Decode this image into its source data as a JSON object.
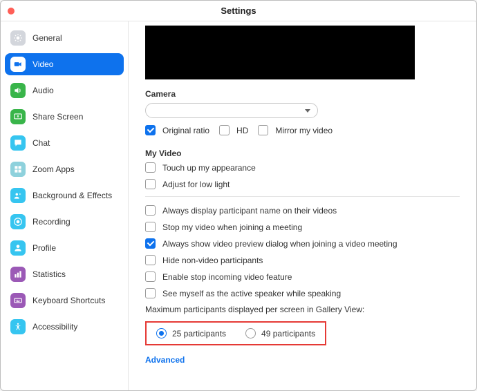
{
  "window": {
    "title": "Settings"
  },
  "sidebar": {
    "items": [
      {
        "id": "general",
        "label": "General",
        "bg": "#d3d6dc",
        "fg": "#fff",
        "active": false
      },
      {
        "id": "video",
        "label": "Video",
        "bg": "#fff",
        "fg": "#0e72ed",
        "active": true
      },
      {
        "id": "audio",
        "label": "Audio",
        "bg": "#39b54a",
        "fg": "#fff",
        "active": false
      },
      {
        "id": "share-screen",
        "label": "Share Screen",
        "bg": "#39b54a",
        "fg": "#fff",
        "active": false
      },
      {
        "id": "chat",
        "label": "Chat",
        "bg": "#36c5f0",
        "fg": "#fff",
        "active": false
      },
      {
        "id": "zoom-apps",
        "label": "Zoom Apps",
        "bg": "#8ed1dc",
        "fg": "#fff",
        "active": false
      },
      {
        "id": "background-effects",
        "label": "Background & Effects",
        "bg": "#36c5f0",
        "fg": "#fff",
        "active": false
      },
      {
        "id": "recording",
        "label": "Recording",
        "bg": "#36c5f0",
        "fg": "#fff",
        "active": false
      },
      {
        "id": "profile",
        "label": "Profile",
        "bg": "#36c5f0",
        "fg": "#fff",
        "active": false
      },
      {
        "id": "statistics",
        "label": "Statistics",
        "bg": "#9b59b6",
        "fg": "#fff",
        "active": false
      },
      {
        "id": "keyboard-shortcuts",
        "label": "Keyboard Shortcuts",
        "bg": "#9b59b6",
        "fg": "#fff",
        "active": false
      },
      {
        "id": "accessibility",
        "label": "Accessibility",
        "bg": "#36c5f0",
        "fg": "#fff",
        "active": false
      }
    ]
  },
  "camera": {
    "heading": "Camera",
    "selected": "",
    "options_row": {
      "original_ratio": {
        "label": "Original ratio",
        "checked": true
      },
      "hd": {
        "label": "HD",
        "checked": false
      },
      "mirror": {
        "label": "Mirror my video",
        "checked": false
      }
    }
  },
  "my_video": {
    "heading": "My Video",
    "touch_up": {
      "label": "Touch up my appearance",
      "checked": false
    },
    "low_light": {
      "label": "Adjust for low light",
      "checked": false
    }
  },
  "meeting_opts": {
    "display_name": {
      "label": "Always display participant name on their videos",
      "checked": false
    },
    "stop_on_join": {
      "label": "Stop my video when joining a meeting",
      "checked": false
    },
    "preview_dialog": {
      "label": "Always show video preview dialog when joining a video meeting",
      "checked": true
    },
    "hide_nonvideo": {
      "label": "Hide non-video participants",
      "checked": false
    },
    "stop_incoming": {
      "label": "Enable stop incoming video feature",
      "checked": false
    },
    "see_self_active": {
      "label": "See myself as the active speaker while speaking",
      "checked": false
    }
  },
  "gallery": {
    "label": "Maximum participants displayed per screen in Gallery View:",
    "opt25": {
      "label": "25 participants",
      "selected": true
    },
    "opt49": {
      "label": "49 participants",
      "selected": false
    }
  },
  "advanced": {
    "label": "Advanced"
  }
}
